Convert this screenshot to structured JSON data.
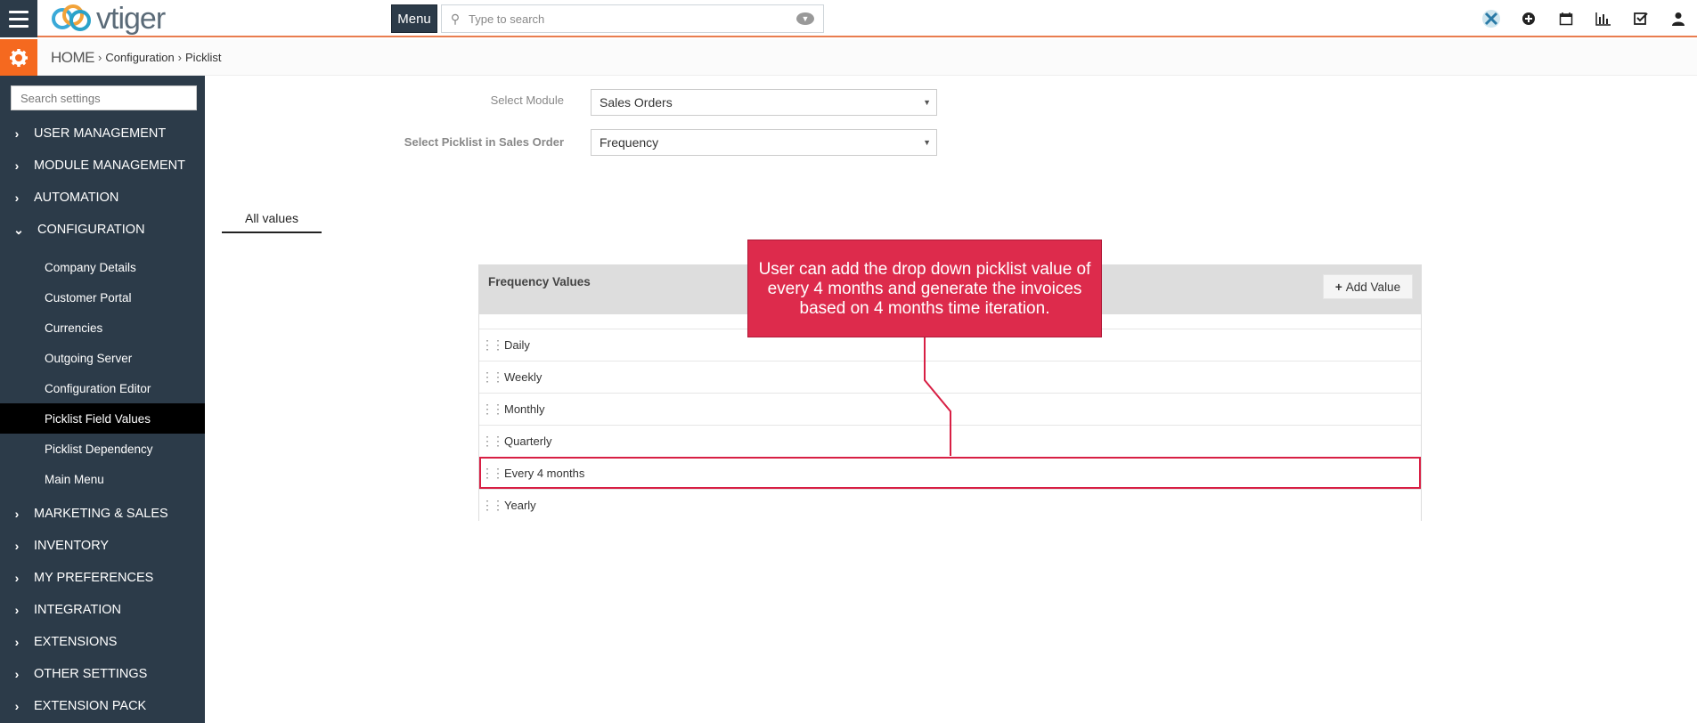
{
  "header": {
    "logo_text": "vtiger",
    "menu_label": "Menu",
    "search_placeholder": "Type to search",
    "icons": [
      "vtiger-x-icon",
      "plus-circle-icon",
      "calendar-icon",
      "bar-chart-icon",
      "checkbox-icon",
      "user-icon"
    ]
  },
  "breadcrumb": {
    "home": "HOME",
    "separator": "›",
    "items": [
      "Configuration",
      "Picklist"
    ]
  },
  "sidebar": {
    "search_placeholder": "Search settings",
    "sections": [
      {
        "label": "USER MANAGEMENT",
        "chevron": "›"
      },
      {
        "label": "MODULE MANAGEMENT",
        "chevron": "›"
      },
      {
        "label": "AUTOMATION",
        "chevron": "›"
      },
      {
        "label": "CONFIGURATION",
        "chevron": "⌄"
      },
      {
        "label": "MARKETING & SALES",
        "chevron": "›"
      },
      {
        "label": "INVENTORY",
        "chevron": "›"
      },
      {
        "label": "MY PREFERENCES",
        "chevron": "›"
      },
      {
        "label": "INTEGRATION",
        "chevron": "›"
      },
      {
        "label": "EXTENSIONS",
        "chevron": "›"
      },
      {
        "label": "OTHER SETTINGS",
        "chevron": "›"
      },
      {
        "label": "EXTENSION PACK",
        "chevron": "›"
      }
    ],
    "config_items": [
      {
        "label": "Company Details"
      },
      {
        "label": "Customer Portal"
      },
      {
        "label": "Currencies"
      },
      {
        "label": "Outgoing Server"
      },
      {
        "label": "Configuration Editor"
      },
      {
        "label": "Picklist Field Values",
        "active": true
      },
      {
        "label": "Picklist Dependency"
      },
      {
        "label": "Main Menu"
      }
    ]
  },
  "form": {
    "module_label": "Select Module",
    "module_value": "Sales Orders",
    "picklist_label": "Select Picklist in Sales Order",
    "picklist_value": "Frequency"
  },
  "tabs": {
    "all_values": "All values"
  },
  "panel": {
    "title": "Frequency Values",
    "add_button": "Add Value",
    "add_icon": "+",
    "values": [
      "Daily",
      "Weekly",
      "Monthly",
      "Quarterly",
      "Every 4 months",
      "Yearly"
    ],
    "highlighted_value": "Every 4 months"
  },
  "callout": {
    "text": "User can add the drop down picklist value of every 4 months and generate the invoices based on 4 months time iteration.",
    "color": "#dd2b4c"
  },
  "colors": {
    "sidebar_bg": "#2c3b49",
    "accent_orange": "#f5691f",
    "highlight_red": "#d81f44"
  }
}
